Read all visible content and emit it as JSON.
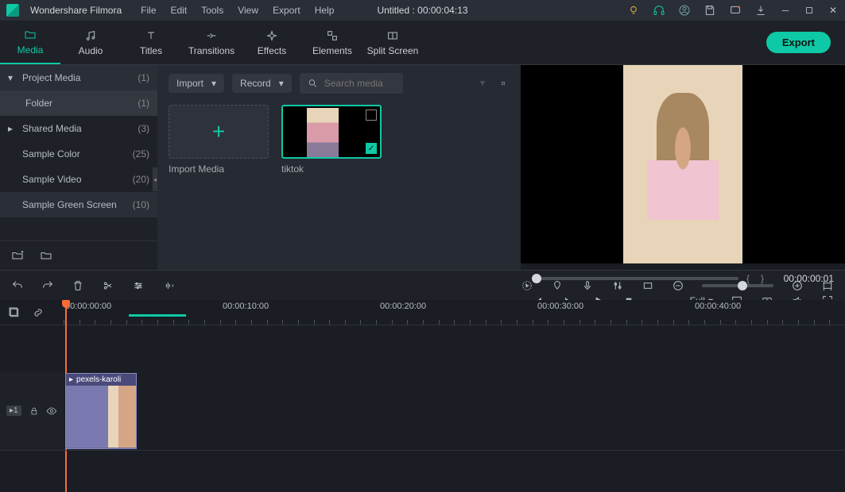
{
  "titlebar": {
    "app_name": "Wondershare Filmora",
    "menus": [
      "File",
      "Edit",
      "Tools",
      "View",
      "Export",
      "Help"
    ],
    "document_title": "Untitled : 00:00:04:13"
  },
  "toolbar": {
    "tabs": [
      {
        "label": "Media"
      },
      {
        "label": "Audio"
      },
      {
        "label": "Titles"
      },
      {
        "label": "Transitions"
      },
      {
        "label": "Effects"
      },
      {
        "label": "Elements"
      },
      {
        "label": "Split Screen"
      }
    ],
    "export_label": "Export"
  },
  "left_tree": {
    "items": [
      {
        "label": "Project Media",
        "count": "(1)",
        "expandable": true,
        "expanded": true
      },
      {
        "label": "Folder",
        "count": "(1)",
        "sub": true
      },
      {
        "label": "Shared Media",
        "count": "(3)",
        "expandable": true,
        "expanded": false
      },
      {
        "label": "Sample Color",
        "count": "(25)"
      },
      {
        "label": "Sample Video",
        "count": "(20)"
      },
      {
        "label": "Sample Green Screen",
        "count": "(10)"
      }
    ]
  },
  "center": {
    "import_label": "Import",
    "record_label": "Record",
    "search_placeholder": "Search media",
    "cards": [
      {
        "label": "Import Media",
        "type": "add"
      },
      {
        "label": "tiktok",
        "type": "clip",
        "selected": true
      }
    ]
  },
  "preview": {
    "timecode": "00:00:00:01",
    "mark_in": "{",
    "mark_out": "}",
    "quality_label": "Full"
  },
  "timeline": {
    "ruler": [
      "00:00:00:00",
      "00:00:10:00",
      "00:00:20:00",
      "00:00:30:00",
      "00:00:40:00"
    ],
    "clip_name": "pexels-karoli",
    "track_badge": "1"
  }
}
